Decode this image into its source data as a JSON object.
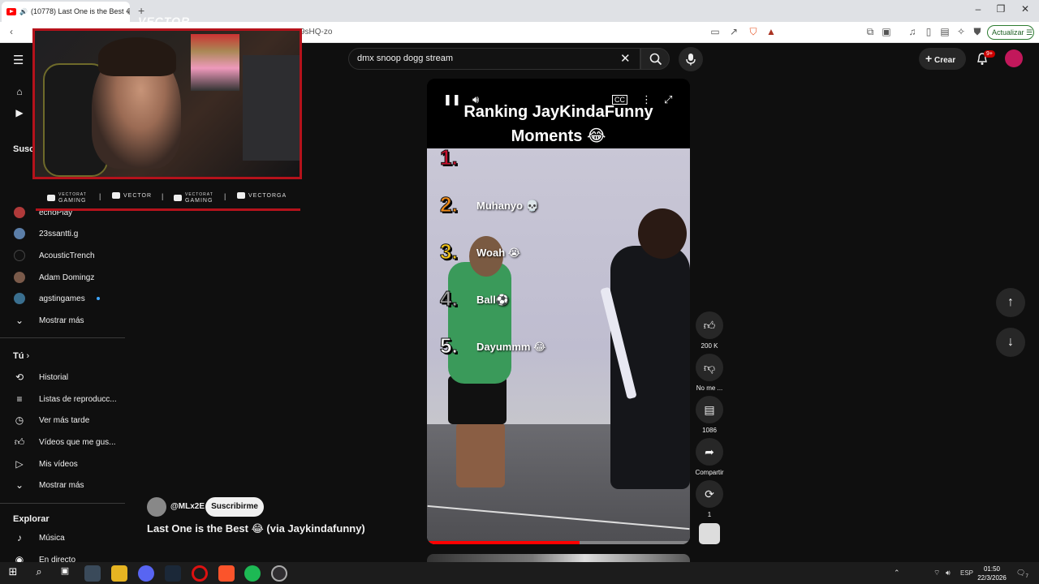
{
  "browser": {
    "tab_title": "(10778) Last One is the Best 😂",
    "url_fragment": "9sHQ-zo",
    "update_label": "Actualizar"
  },
  "header": {
    "search_value": "dmx snoop dogg stream",
    "create_label": "Crear",
    "notif_badge": "9+"
  },
  "sidebar": {
    "subs_title": "Susc",
    "subscriptions": [
      {
        "label": "echoPlay",
        "color": "#b03a3a"
      },
      {
        "label": "23ssantti.g",
        "color": "#5b7ea8"
      },
      {
        "label": "AcousticTrench",
        "color": "#111111"
      },
      {
        "label": "Adam Domingz",
        "color": "#7a5a4a"
      },
      {
        "label": "agstingames",
        "color": "#3a6f8f"
      }
    ],
    "show_more_1": "Mostrar más",
    "you_title": "Tú",
    "you_items": [
      {
        "label": "Historial",
        "icon": "history-icon"
      },
      {
        "label": "Listas de reproducc...",
        "icon": "playlist-icon"
      },
      {
        "label": "Ver más tarde",
        "icon": "clock-icon"
      },
      {
        "label": "Vídeos que me gus...",
        "icon": "thumb-up-icon"
      },
      {
        "label": "Mis vídeos",
        "icon": "my-videos-icon"
      }
    ],
    "show_more_2": "Mostrar más",
    "explore_title": "Explorar",
    "explore_items": [
      {
        "label": "Música",
        "icon": "music-icon"
      },
      {
        "label": "En directo",
        "icon": "live-icon"
      }
    ]
  },
  "overlay": {
    "logo_text": "VECTOR",
    "social": [
      {
        "label": "GAMING",
        "top": "VECTORAT",
        "icon": "youtube-icon"
      },
      {
        "label": "VECTOR",
        "top": "",
        "icon": "twitch-icon"
      },
      {
        "label": "GAMING",
        "top": "VECTORAT",
        "icon": "twitter-icon"
      },
      {
        "label": "VECTORGA",
        "top": "",
        "icon": "instagram-icon"
      }
    ]
  },
  "video": {
    "title": "Ranking JayKindaFunny Moments 😂",
    "ranks": [
      {
        "num": "1.",
        "label": "",
        "color": "#c8102e"
      },
      {
        "num": "2.",
        "label": "Muhanyo 💀",
        "color": "#f08c1a"
      },
      {
        "num": "3.",
        "label": "Woah 😭",
        "color": "#f2c418"
      },
      {
        "num": "4.",
        "label": "Ball⚽",
        "color": "#9a9a9a"
      },
      {
        "num": "5.",
        "label": "Dayummm 😂",
        "color": "#ffffff"
      }
    ],
    "progress": 0.58
  },
  "actions": {
    "likes": "200 K",
    "dislike": "No me ...",
    "comments": "1086",
    "share": "Compartir",
    "remix": "1"
  },
  "channel": {
    "name": "@MLx2E",
    "subscribe_label": "Suscribirme",
    "video_title": "Last One is the Best 😂  (via Jaykindafunny)"
  },
  "taskbar": {
    "lang": "ESP",
    "time": "01:50",
    "date": "22/3/2026",
    "notif_count": "7"
  }
}
